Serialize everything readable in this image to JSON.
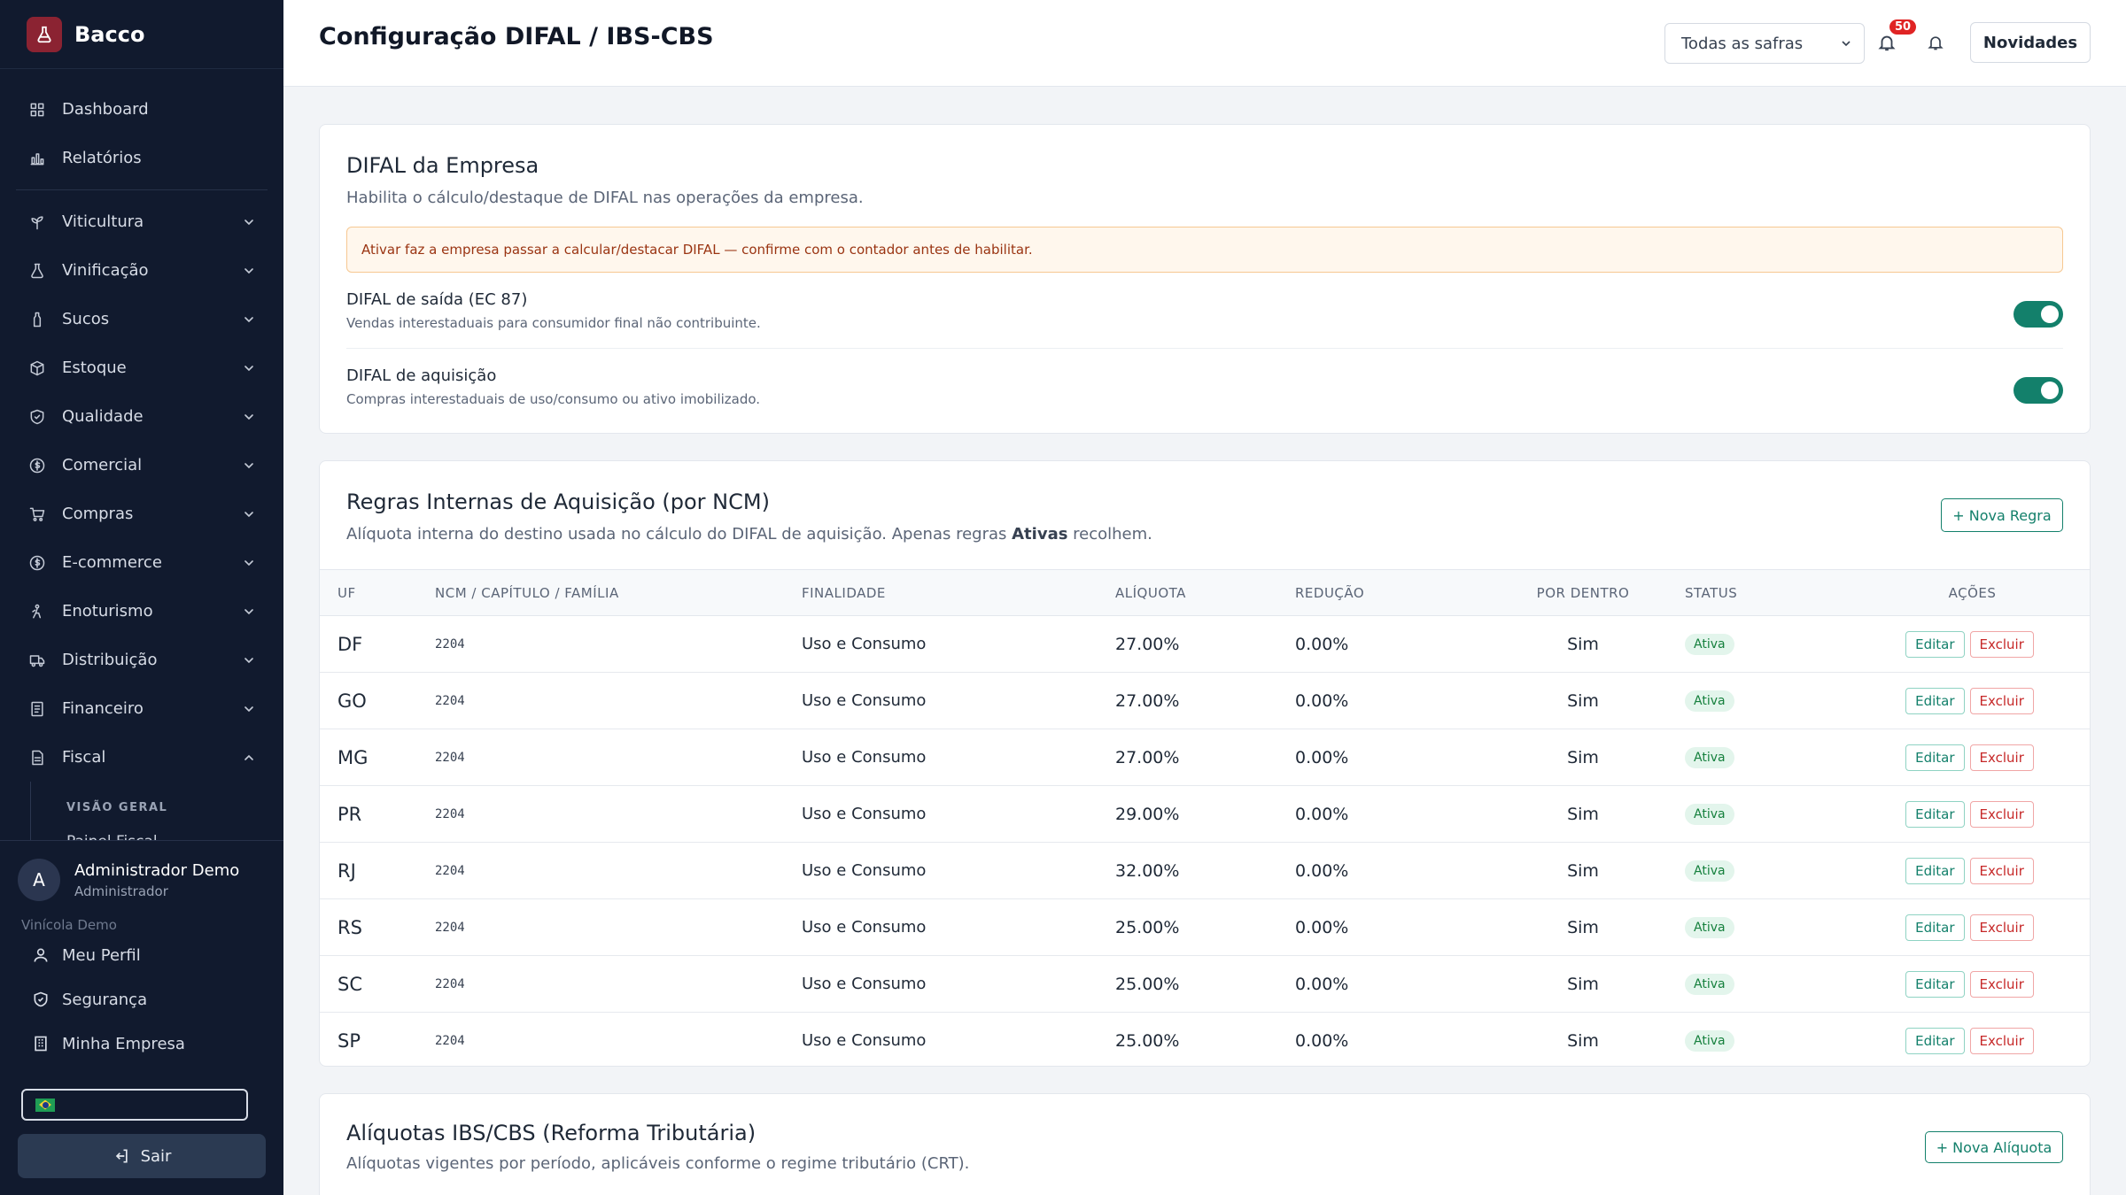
{
  "brand": {
    "name": "Bacco"
  },
  "sidebar": {
    "items": [
      {
        "label": "Dashboard",
        "icon": "grid-icon",
        "expandable": false
      },
      {
        "label": "Relatórios",
        "icon": "bar-chart-icon",
        "expandable": false
      },
      {
        "label": "Viticultura",
        "icon": "sprout-icon",
        "expandable": true
      },
      {
        "label": "Vinificação",
        "icon": "flask-icon",
        "expandable": true
      },
      {
        "label": "Sucos",
        "icon": "bottle-icon",
        "expandable": true
      },
      {
        "label": "Estoque",
        "icon": "box-icon",
        "expandable": true
      },
      {
        "label": "Qualidade",
        "icon": "shield-check-icon",
        "expandable": true
      },
      {
        "label": "Comercial",
        "icon": "dollar-circle-icon",
        "expandable": true
      },
      {
        "label": "Compras",
        "icon": "cart-icon",
        "expandable": true
      },
      {
        "label": "E-commerce",
        "icon": "dollar-circle-icon",
        "expandable": true
      },
      {
        "label": "Enoturismo",
        "icon": "hiker-icon",
        "expandable": true
      },
      {
        "label": "Distribuição",
        "icon": "truck-icon",
        "expandable": true
      },
      {
        "label": "Financeiro",
        "icon": "receipt-icon",
        "expandable": true
      },
      {
        "label": "Fiscal",
        "icon": "document-icon",
        "expandable": true,
        "expanded": true
      }
    ],
    "fiscal_sub": {
      "heading": "VISÃO GERAL",
      "items": [
        "Painel Fiscal"
      ]
    }
  },
  "user": {
    "initial": "A",
    "name": "Administrador Demo",
    "role": "Administrador",
    "company": "Vinícola Demo",
    "links": [
      "Meu Perfil",
      "Segurança",
      "Minha Empresa"
    ],
    "logout_label": "Sair"
  },
  "header": {
    "title": "Configuração DIFAL / IBS-CBS",
    "safra_select": "Todas as safras",
    "notification_count": "50",
    "news_label": "Novidades"
  },
  "difal_card": {
    "title": "DIFAL da Empresa",
    "subtitle": "Habilita o cálculo/destaque de DIFAL nas operações da empresa.",
    "warning": "Ativar faz a empresa passar a calcular/destacar DIFAL — confirme com o contador antes de habilitar.",
    "toggles": [
      {
        "label": "DIFAL de saída (EC 87)",
        "desc": "Vendas interestaduais para consumidor final não contribuinte.",
        "on": true
      },
      {
        "label": "DIFAL de aquisição",
        "desc": "Compras interestaduais de uso/consumo ou ativo imobilizado.",
        "on": true
      }
    ]
  },
  "rules_card": {
    "title": "Regras Internas de Aquisição (por NCM)",
    "subtitle_pre": "Alíquota interna do destino usada no cálculo do DIFAL de aquisição. Apenas regras ",
    "subtitle_bold": "Ativas",
    "subtitle_post": " recolhem.",
    "new_button": "+ Nova Regra",
    "columns": [
      "UF",
      "NCM / CAPÍTULO / FAMÍLIA",
      "FINALIDADE",
      "ALÍQUOTA",
      "REDUÇÃO",
      "POR DENTRO",
      "STATUS",
      "AÇÕES"
    ],
    "edit_label": "Editar",
    "delete_label": "Excluir",
    "rows": [
      {
        "uf": "DF",
        "ncm": "2204",
        "finalidade": "Uso e Consumo",
        "aliquota": "27.00%",
        "reducao": "0.00%",
        "por_dentro": "Sim",
        "status": "Ativa"
      },
      {
        "uf": "GO",
        "ncm": "2204",
        "finalidade": "Uso e Consumo",
        "aliquota": "27.00%",
        "reducao": "0.00%",
        "por_dentro": "Sim",
        "status": "Ativa"
      },
      {
        "uf": "MG",
        "ncm": "2204",
        "finalidade": "Uso e Consumo",
        "aliquota": "27.00%",
        "reducao": "0.00%",
        "por_dentro": "Sim",
        "status": "Ativa"
      },
      {
        "uf": "PR",
        "ncm": "2204",
        "finalidade": "Uso e Consumo",
        "aliquota": "29.00%",
        "reducao": "0.00%",
        "por_dentro": "Sim",
        "status": "Ativa"
      },
      {
        "uf": "RJ",
        "ncm": "2204",
        "finalidade": "Uso e Consumo",
        "aliquota": "32.00%",
        "reducao": "0.00%",
        "por_dentro": "Sim",
        "status": "Ativa"
      },
      {
        "uf": "RS",
        "ncm": "2204",
        "finalidade": "Uso e Consumo",
        "aliquota": "25.00%",
        "reducao": "0.00%",
        "por_dentro": "Sim",
        "status": "Ativa"
      },
      {
        "uf": "SC",
        "ncm": "2204",
        "finalidade": "Uso e Consumo",
        "aliquota": "25.00%",
        "reducao": "0.00%",
        "por_dentro": "Sim",
        "status": "Ativa"
      },
      {
        "uf": "SP",
        "ncm": "2204",
        "finalidade": "Uso e Consumo",
        "aliquota": "25.00%",
        "reducao": "0.00%",
        "por_dentro": "Sim",
        "status": "Ativa"
      }
    ]
  },
  "ibs_card": {
    "title": "Alíquotas IBS/CBS (Reforma Tributária)",
    "subtitle": "Alíquotas vigentes por período, aplicáveis conforme o regime tributário (CRT).",
    "new_button": "+ Nova Alíquota"
  },
  "colors": {
    "sidebar_bg": "#111a2e",
    "accent": "#13806b",
    "brand": "#8b2332",
    "danger": "#c62828"
  }
}
